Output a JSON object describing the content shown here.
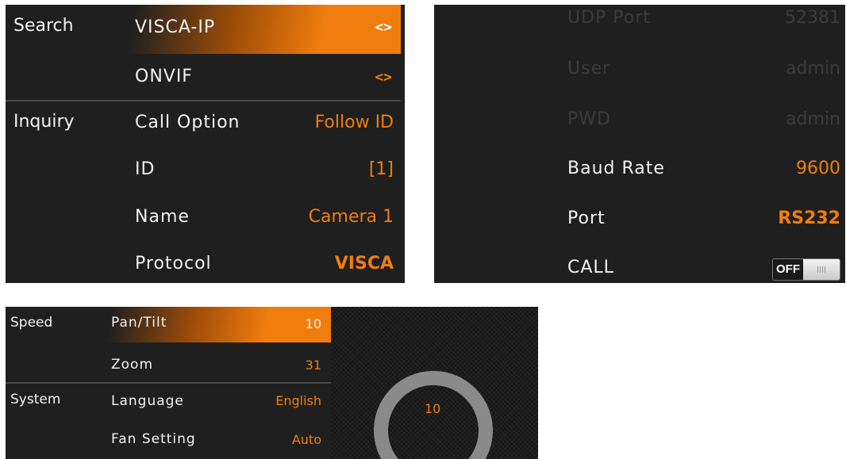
{
  "panel1": {
    "rows": [
      {
        "section": "Search",
        "label": "VISCA-IP",
        "value": "<>"
      },
      {
        "label": "ONVIF",
        "value": "<>"
      },
      {
        "section": "Inquiry",
        "label": "Call Option",
        "value": "Follow ID"
      },
      {
        "label": "ID",
        "value": "[1]"
      },
      {
        "label": "Name",
        "value": "Camera 1"
      },
      {
        "label": "Protocol",
        "value": "VISCA"
      }
    ]
  },
  "panel2": {
    "rows": [
      {
        "label": "UDP Port",
        "value": "52381"
      },
      {
        "label": "User",
        "value": "admin"
      },
      {
        "label": "PWD",
        "value": "admin"
      },
      {
        "label": "Baud Rate",
        "value": "9600"
      },
      {
        "label": "Port",
        "value": "RS232"
      },
      {
        "label": "CALL",
        "toggle": "OFF"
      }
    ]
  },
  "panel3": {
    "rows": [
      {
        "section": "Speed",
        "label": "Pan/Tilt",
        "value": "10"
      },
      {
        "label": "Zoom",
        "value": "31"
      },
      {
        "section": "System",
        "label": "Language",
        "value": "English"
      },
      {
        "label": "Fan Setting",
        "value": "Auto"
      }
    ],
    "dial": {
      "value": "10",
      "level": 10,
      "max": 31
    }
  },
  "colors": {
    "accent": "#f07d0e",
    "panel_bg": "#1f1f1f",
    "text": "#f2f2f2",
    "dimmed": "#3c3c3c",
    "dial_arc": "#8a8a8a"
  }
}
